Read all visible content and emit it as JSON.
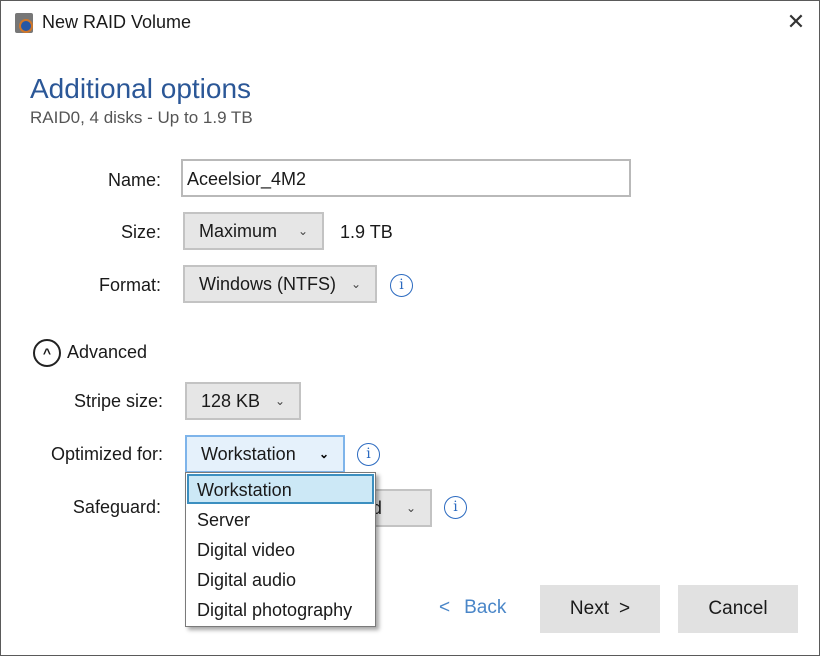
{
  "window": {
    "title": "New RAID Volume",
    "close": "✕"
  },
  "header": {
    "title": "Additional options",
    "subtitle": "RAID0, 4 disks - Up to 1.9 TB"
  },
  "form": {
    "name_label": "Name:",
    "name_value": "Aceelsior_4M2",
    "size_label": "Size:",
    "size_value": "Maximum",
    "size_text": "1.9 TB",
    "format_label": "Format:",
    "format_value": "Windows (NTFS)",
    "advanced_label": "Advanced",
    "stripe_label": "Stripe size:",
    "stripe_value": "128 KB",
    "optimized_label": "Optimized for:",
    "optimized_value": "Workstation",
    "safeguard_label": "Safeguard:",
    "safeguard_visible_value": "rd",
    "optimized_options": [
      "Workstation",
      "Server",
      "Digital video",
      "Digital audio",
      "Digital photography"
    ]
  },
  "buttons": {
    "back": "Back",
    "next": "Next",
    "cancel": "Cancel"
  },
  "colors": {
    "accent": "#2b5797",
    "info": "#2b6ac0",
    "selected_option": "#cce8f6"
  }
}
